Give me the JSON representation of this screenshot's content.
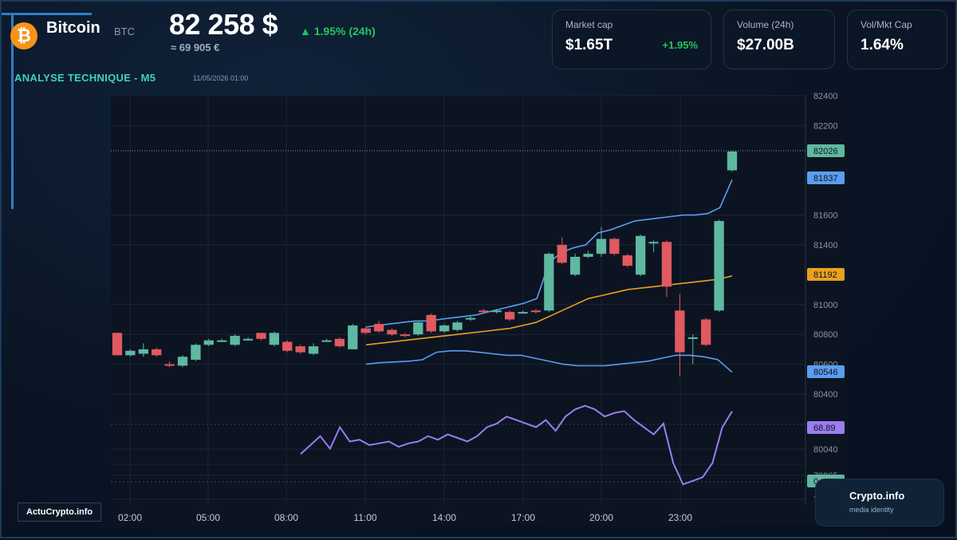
{
  "header": {
    "coin_name": "Bitcoin",
    "ticker": "BTC",
    "price": "82 258 $",
    "change": "▲ 1.95% (24h)",
    "price_eur": "≈ 69 905 €",
    "analysis_title": "ANALYSE TECHNIQUE - M5",
    "datetime": "11/05/2026 01:00",
    "logo_symbol": "₿"
  },
  "cards": [
    {
      "label": "Market cap",
      "value": "$1.65T",
      "delta": "+1.95%"
    },
    {
      "label": "Volume (24h)",
      "value": "$27.00B"
    },
    {
      "label": "Vol/Mkt Cap",
      "value": "1.64%"
    }
  ],
  "branding": {
    "badge": "ActuCrypto.info",
    "title": "Crypto.info",
    "subtitle": "media identity"
  },
  "colors": {
    "up": "#5fb8a0",
    "down": "#e05a5f",
    "bollinger": "#5b9df0",
    "ma": "#e8a01e",
    "rsi": "#9b7cf0",
    "accent_green": "#22c55e",
    "accent_teal": "#3fd1c0"
  },
  "chart_data": {
    "type": "candlestick",
    "x_labels": [
      "02:00",
      "05:00",
      "08:00",
      "11:00",
      "14:00",
      "17:00",
      "20:00",
      "23:00"
    ],
    "y_ticks": [
      82400,
      82200,
      81600,
      81400,
      81000,
      80800,
      80600,
      80400,
      80040,
      79865,
      79705
    ],
    "price_tags": [
      {
        "value": "82026",
        "color": "#5fb8a0"
      },
      {
        "value": "81837",
        "color": "#5b9df0"
      },
      {
        "value": "81192",
        "color": "#e8a01e"
      },
      {
        "value": "80546",
        "color": "#5b9df0"
      },
      {
        "value": "68.89",
        "color": "#9b7cf0"
      },
      {
        "value": "0",
        "color": "#5fb8a0"
      }
    ],
    "candles": [
      {
        "o": 80810,
        "c": 80660,
        "h": 80810,
        "l": 80660
      },
      {
        "o": 80660,
        "c": 80690,
        "h": 80700,
        "l": 80650
      },
      {
        "o": 80670,
        "c": 80700,
        "h": 80740,
        "l": 80650
      },
      {
        "o": 80700,
        "c": 80660,
        "h": 80710,
        "l": 80650
      },
      {
        "o": 80600,
        "c": 80590,
        "h": 80620,
        "l": 80580
      },
      {
        "o": 80590,
        "c": 80650,
        "h": 80660,
        "l": 80580
      },
      {
        "o": 80630,
        "c": 80730,
        "h": 80740,
        "l": 80620
      },
      {
        "o": 80730,
        "c": 80760,
        "h": 80770,
        "l": 80720
      },
      {
        "o": 80760,
        "c": 80760,
        "h": 80770,
        "l": 80750
      },
      {
        "o": 80730,
        "c": 80790,
        "h": 80800,
        "l": 80720
      },
      {
        "o": 80770,
        "c": 80770,
        "h": 80780,
        "l": 80760
      },
      {
        "o": 80810,
        "c": 80770,
        "h": 80810,
        "l": 80760
      },
      {
        "o": 80730,
        "c": 80810,
        "h": 80820,
        "l": 80720
      },
      {
        "o": 80750,
        "c": 80690,
        "h": 80760,
        "l": 80680
      },
      {
        "o": 80720,
        "c": 80680,
        "h": 80730,
        "l": 80670
      },
      {
        "o": 80670,
        "c": 80720,
        "h": 80740,
        "l": 80660
      },
      {
        "o": 80760,
        "c": 80760,
        "h": 80770,
        "l": 80750
      },
      {
        "o": 80770,
        "c": 80720,
        "h": 80780,
        "l": 80710
      },
      {
        "o": 80700,
        "c": 80860,
        "h": 80870,
        "l": 80700
      },
      {
        "o": 80840,
        "c": 80810,
        "h": 80850,
        "l": 80800
      },
      {
        "o": 80870,
        "c": 80820,
        "h": 80890,
        "l": 80810
      },
      {
        "o": 80830,
        "c": 80800,
        "h": 80840,
        "l": 80790
      },
      {
        "o": 80800,
        "c": 80790,
        "h": 80810,
        "l": 80780
      },
      {
        "o": 80800,
        "c": 80880,
        "h": 80890,
        "l": 80790
      },
      {
        "o": 80930,
        "c": 80820,
        "h": 80940,
        "l": 80810
      },
      {
        "o": 80820,
        "c": 80860,
        "h": 80870,
        "l": 80810
      },
      {
        "o": 80830,
        "c": 80880,
        "h": 80890,
        "l": 80820
      },
      {
        "o": 80900,
        "c": 80910,
        "h": 80920,
        "l": 80890
      },
      {
        "o": 80960,
        "c": 80950,
        "h": 80970,
        "l": 80940
      },
      {
        "o": 80950,
        "c": 80960,
        "h": 80970,
        "l": 80940
      },
      {
        "o": 80950,
        "c": 80900,
        "h": 80960,
        "l": 80890
      },
      {
        "o": 80950,
        "c": 80950,
        "h": 80960,
        "l": 80940
      },
      {
        "o": 80960,
        "c": 80950,
        "h": 80970,
        "l": 80940
      },
      {
        "o": 80960,
        "c": 81340,
        "h": 81350,
        "l": 80950
      },
      {
        "o": 81400,
        "c": 81280,
        "h": 81450,
        "l": 81270
      },
      {
        "o": 81200,
        "c": 81320,
        "h": 81340,
        "l": 81190
      },
      {
        "o": 81320,
        "c": 81340,
        "h": 81360,
        "l": 81310
      },
      {
        "o": 81340,
        "c": 81440,
        "h": 81520,
        "l": 81320
      },
      {
        "o": 81440,
        "c": 81340,
        "h": 81450,
        "l": 81330
      },
      {
        "o": 81330,
        "c": 81260,
        "h": 81340,
        "l": 81250
      },
      {
        "o": 81200,
        "c": 81460,
        "h": 81470,
        "l": 81190
      },
      {
        "o": 81420,
        "c": 81420,
        "h": 81430,
        "l": 81350
      },
      {
        "o": 81420,
        "c": 81120,
        "h": 81430,
        "l": 81050
      },
      {
        "o": 80960,
        "c": 80680,
        "h": 81070,
        "l": 80520
      },
      {
        "o": 80780,
        "c": 80780,
        "h": 80800,
        "l": 80600
      },
      {
        "o": 80900,
        "c": 80730,
        "h": 80910,
        "l": 80720
      },
      {
        "o": 80960,
        "c": 81560,
        "h": 81570,
        "l": 80950
      },
      {
        "o": 81900,
        "c": 82026,
        "h": 82030,
        "l": 81890
      }
    ],
    "bollinger_upper": [
      80850,
      80860,
      80870,
      80880,
      80890,
      80890,
      80900,
      80910,
      80920,
      80930,
      80950,
      80970,
      80990,
      81010,
      81040,
      81280,
      81350,
      81380,
      81400,
      81480,
      81500,
      81530,
      81560,
      81570,
      81580,
      81590,
      81600,
      81600,
      81610,
      81650,
      81837
    ],
    "bollinger_lower": [
      80600,
      80610,
      80615,
      80620,
      80630,
      80680,
      80690,
      80690,
      80680,
      80670,
      80660,
      80660,
      80640,
      80620,
      80600,
      80590,
      80590,
      80590,
      80600,
      80610,
      80620,
      80640,
      80660,
      80660,
      80650,
      80630,
      80546
    ],
    "moving_average": [
      80730,
      80740,
      80750,
      80760,
      80770,
      80780,
      80790,
      80800,
      80810,
      80820,
      80830,
      80840,
      80860,
      80880,
      80920,
      80960,
      81000,
      81040,
      81060,
      81080,
      81100,
      81110,
      81120,
      81130,
      81140,
      81150,
      81160,
      81170,
      81192
    ],
    "rsi": [
      45,
      50,
      55,
      48,
      60,
      52,
      53,
      50,
      51,
      52,
      49,
      51,
      52,
      55,
      53,
      56,
      54,
      52,
      55,
      60,
      62,
      66,
      64,
      62,
      60,
      64,
      58,
      66,
      70,
      72,
      70,
      66,
      68,
      69,
      64,
      60,
      56,
      62,
      40,
      28,
      30,
      32,
      40,
      60,
      68.89
    ]
  }
}
